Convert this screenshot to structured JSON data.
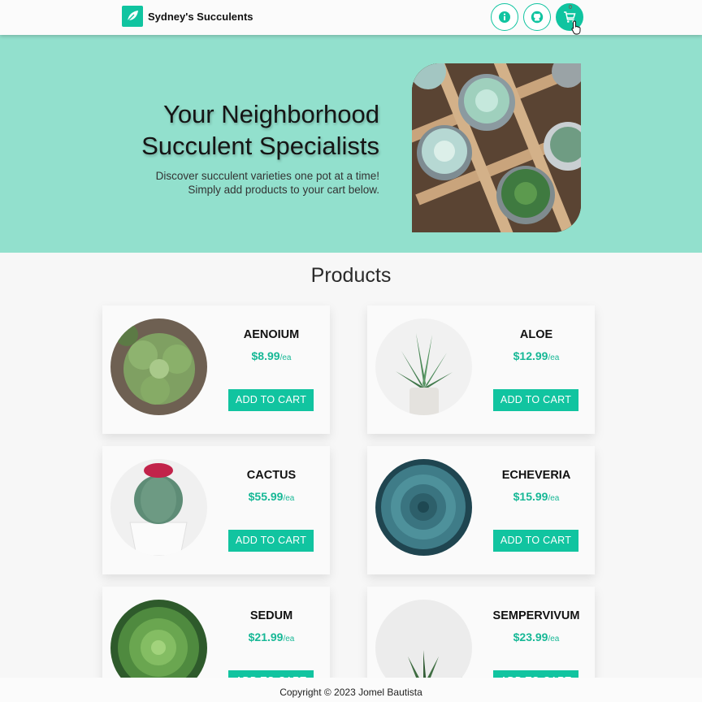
{
  "navbar": {
    "brand_name": "Sydney's Succulents",
    "brand_icon": "leaf-icon",
    "buttons": [
      {
        "name": "info",
        "icon": "info-icon"
      },
      {
        "name": "github",
        "icon": "github-icon"
      },
      {
        "name": "cart",
        "icon": "cart-icon",
        "badge": "0"
      }
    ]
  },
  "hero": {
    "title_line1": "Your Neighborhood",
    "title_line2": "Succulent Specialists",
    "sub_line1": "Discover succulent varieties one pot at a time!",
    "sub_line2": "Simply add products to your cart below."
  },
  "products": {
    "title": "Products",
    "add_label": "ADD TO CART",
    "unit": "/ea",
    "items": [
      {
        "name": "AENOIUM",
        "price": "$8.99"
      },
      {
        "name": "ALOE",
        "price": "$12.99"
      },
      {
        "name": "CACTUS",
        "price": "$55.99"
      },
      {
        "name": "ECHEVERIA",
        "price": "$15.99"
      },
      {
        "name": "SEDUM",
        "price": "$21.99"
      },
      {
        "name": "SEMPERVIVUM",
        "price": "$23.99"
      }
    ]
  },
  "footer": {
    "text": "Copyright © 2023 Jomel Bautista"
  },
  "colors": {
    "accent": "#10c4a0",
    "hero_bg": "#92e0cd",
    "price": "#17b896"
  }
}
